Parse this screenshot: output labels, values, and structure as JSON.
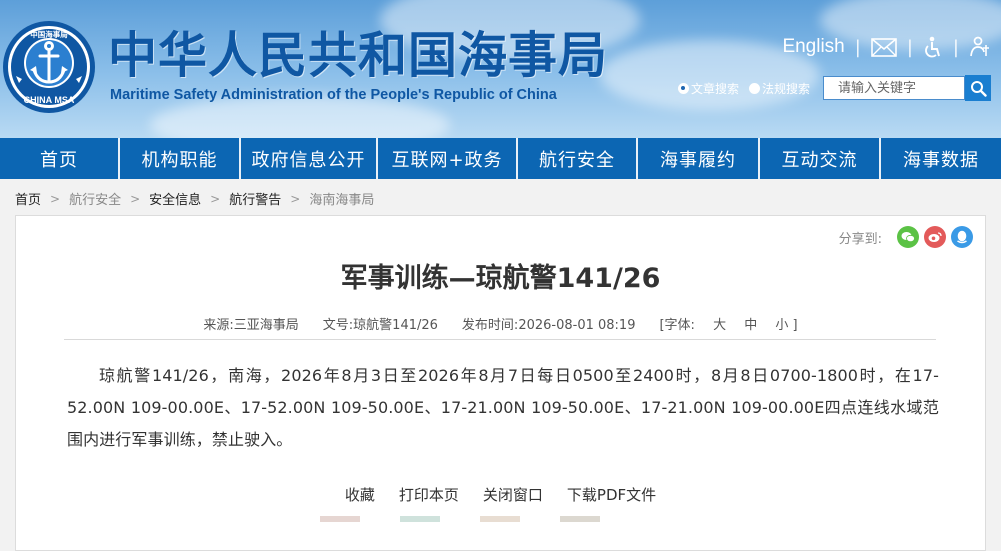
{
  "header": {
    "logo_text_top": "中国海事局",
    "logo_text_bottom": "CHINA MSA",
    "title": "中华人民共和国海事局",
    "subtitle": "Maritime Safety Administration of the People's Republic of China",
    "english_link": "English",
    "icons": [
      "mail-icon",
      "accessibility-icon",
      "elderly-mode-icon"
    ],
    "search": {
      "option_article": "文章搜索",
      "option_law": "法规搜索",
      "selected": "文章搜索",
      "placeholder": "请输入关键字"
    }
  },
  "nav": {
    "items": [
      "首页",
      "机构职能",
      "政府信息公开",
      "互联网+政务",
      "航行安全",
      "海事履约",
      "互动交流",
      "海事数据"
    ]
  },
  "breadcrumb": [
    "首页",
    "航行安全",
    "安全信息",
    "航行警告",
    "海南海事局"
  ],
  "article": {
    "share_label": "分享到:",
    "share_icons": [
      "wechat-icon",
      "weibo-icon",
      "qq-icon"
    ],
    "title": "军事训练—琼航警141/26",
    "source_label": "来源:",
    "source": "三亚海事局",
    "docno_label": "文号:",
    "docno": "琼航警141/26",
    "time_label": "发布时间:",
    "time": "2026-08-01 08:19",
    "font_label": "[字体:",
    "font_large": "大",
    "font_medium": "中",
    "font_small": "小",
    "font_close": "]",
    "body": "琼航警141/26，南海，2026年8月3日至2026年8月7日每日0500至2400时，8月8日0700-1800时，在17-52.00N 109-00.00E、17-52.00N 109-50.00E、17-21.00N 109-50.00E、17-21.00N 109-00.00E四点连线水域范围内进行军事训练，禁止驶入。",
    "actions": [
      "收藏",
      "打印本页",
      "关闭窗口",
      "下载PDF文件"
    ]
  },
  "colors": {
    "nav_bg": "#0c66b3",
    "title_blue": "#0f57a3",
    "wechat": "#5bc245",
    "weibo": "#e35a5a",
    "qq": "#3a9ae6"
  }
}
